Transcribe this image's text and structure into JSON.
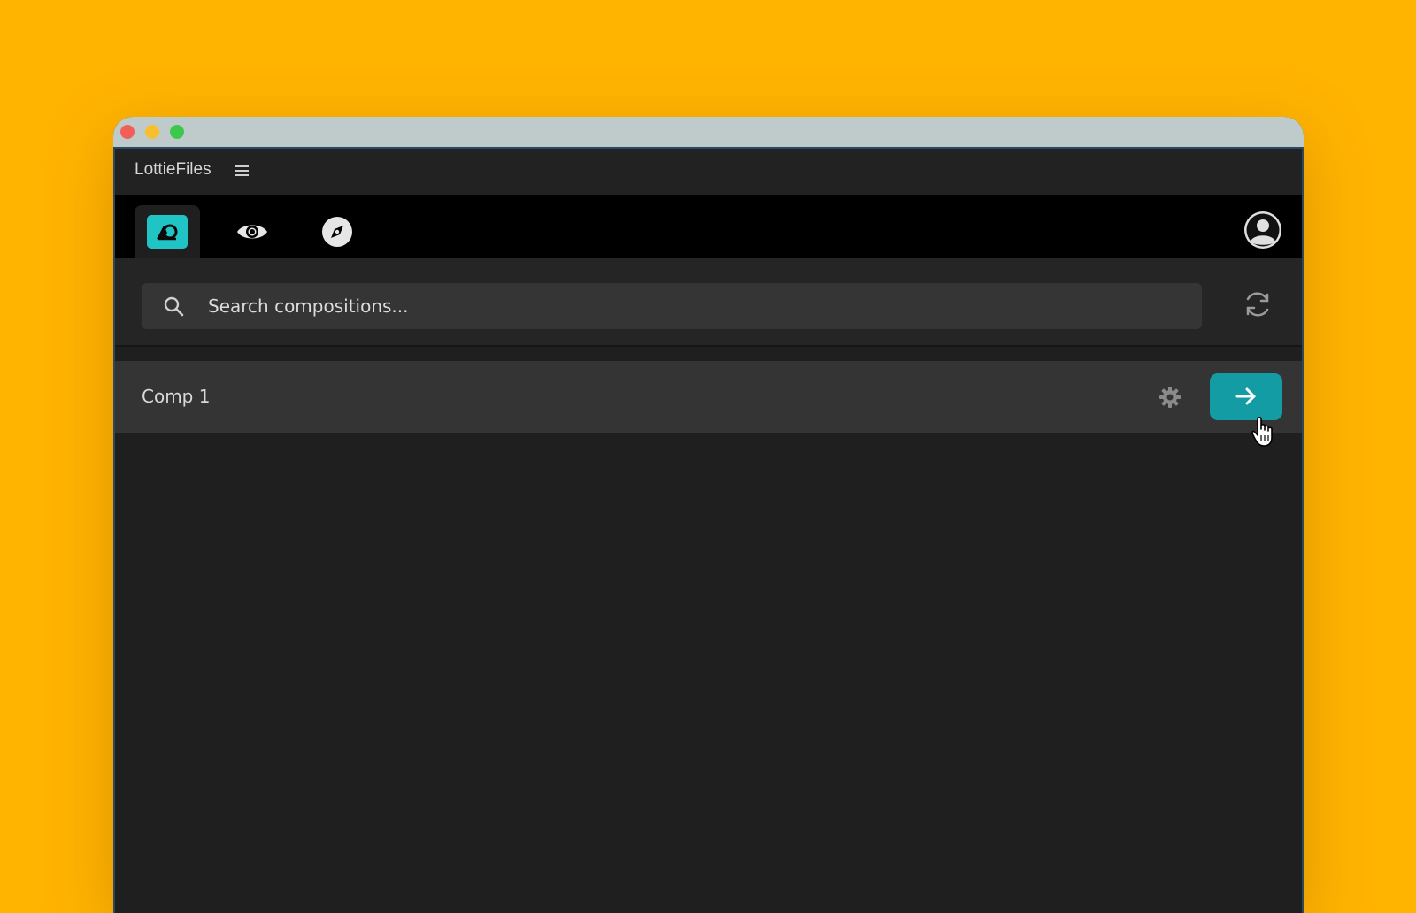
{
  "window": {
    "traffic_lights": {
      "close_color": "#F25F58",
      "minimize_color": "#F9BE2E",
      "maximize_color": "#3CC84A"
    }
  },
  "app": {
    "title": "LottieFiles",
    "menu_icon": "hamburger-icon"
  },
  "tabs": [
    {
      "name": "after-effects-export",
      "icon": "lottie-ae-logo-icon",
      "active": true
    },
    {
      "name": "preview",
      "icon": "eye-icon",
      "active": false
    },
    {
      "name": "discover",
      "icon": "compass-icon",
      "active": false
    }
  ],
  "user": {
    "icon": "user-avatar-icon"
  },
  "search": {
    "placeholder": "Search compositions...",
    "value": "",
    "icon": "search-icon"
  },
  "refresh": {
    "icon": "refresh-icon"
  },
  "compositions": [
    {
      "name": "Comp 1",
      "settings_icon": "gear-icon",
      "action_icon": "arrow-right-icon"
    }
  ],
  "colors": {
    "background": "#FFB400",
    "accent": "#21C4C5",
    "action_button": "#139CA3",
    "panel": "#1F1F1F"
  }
}
